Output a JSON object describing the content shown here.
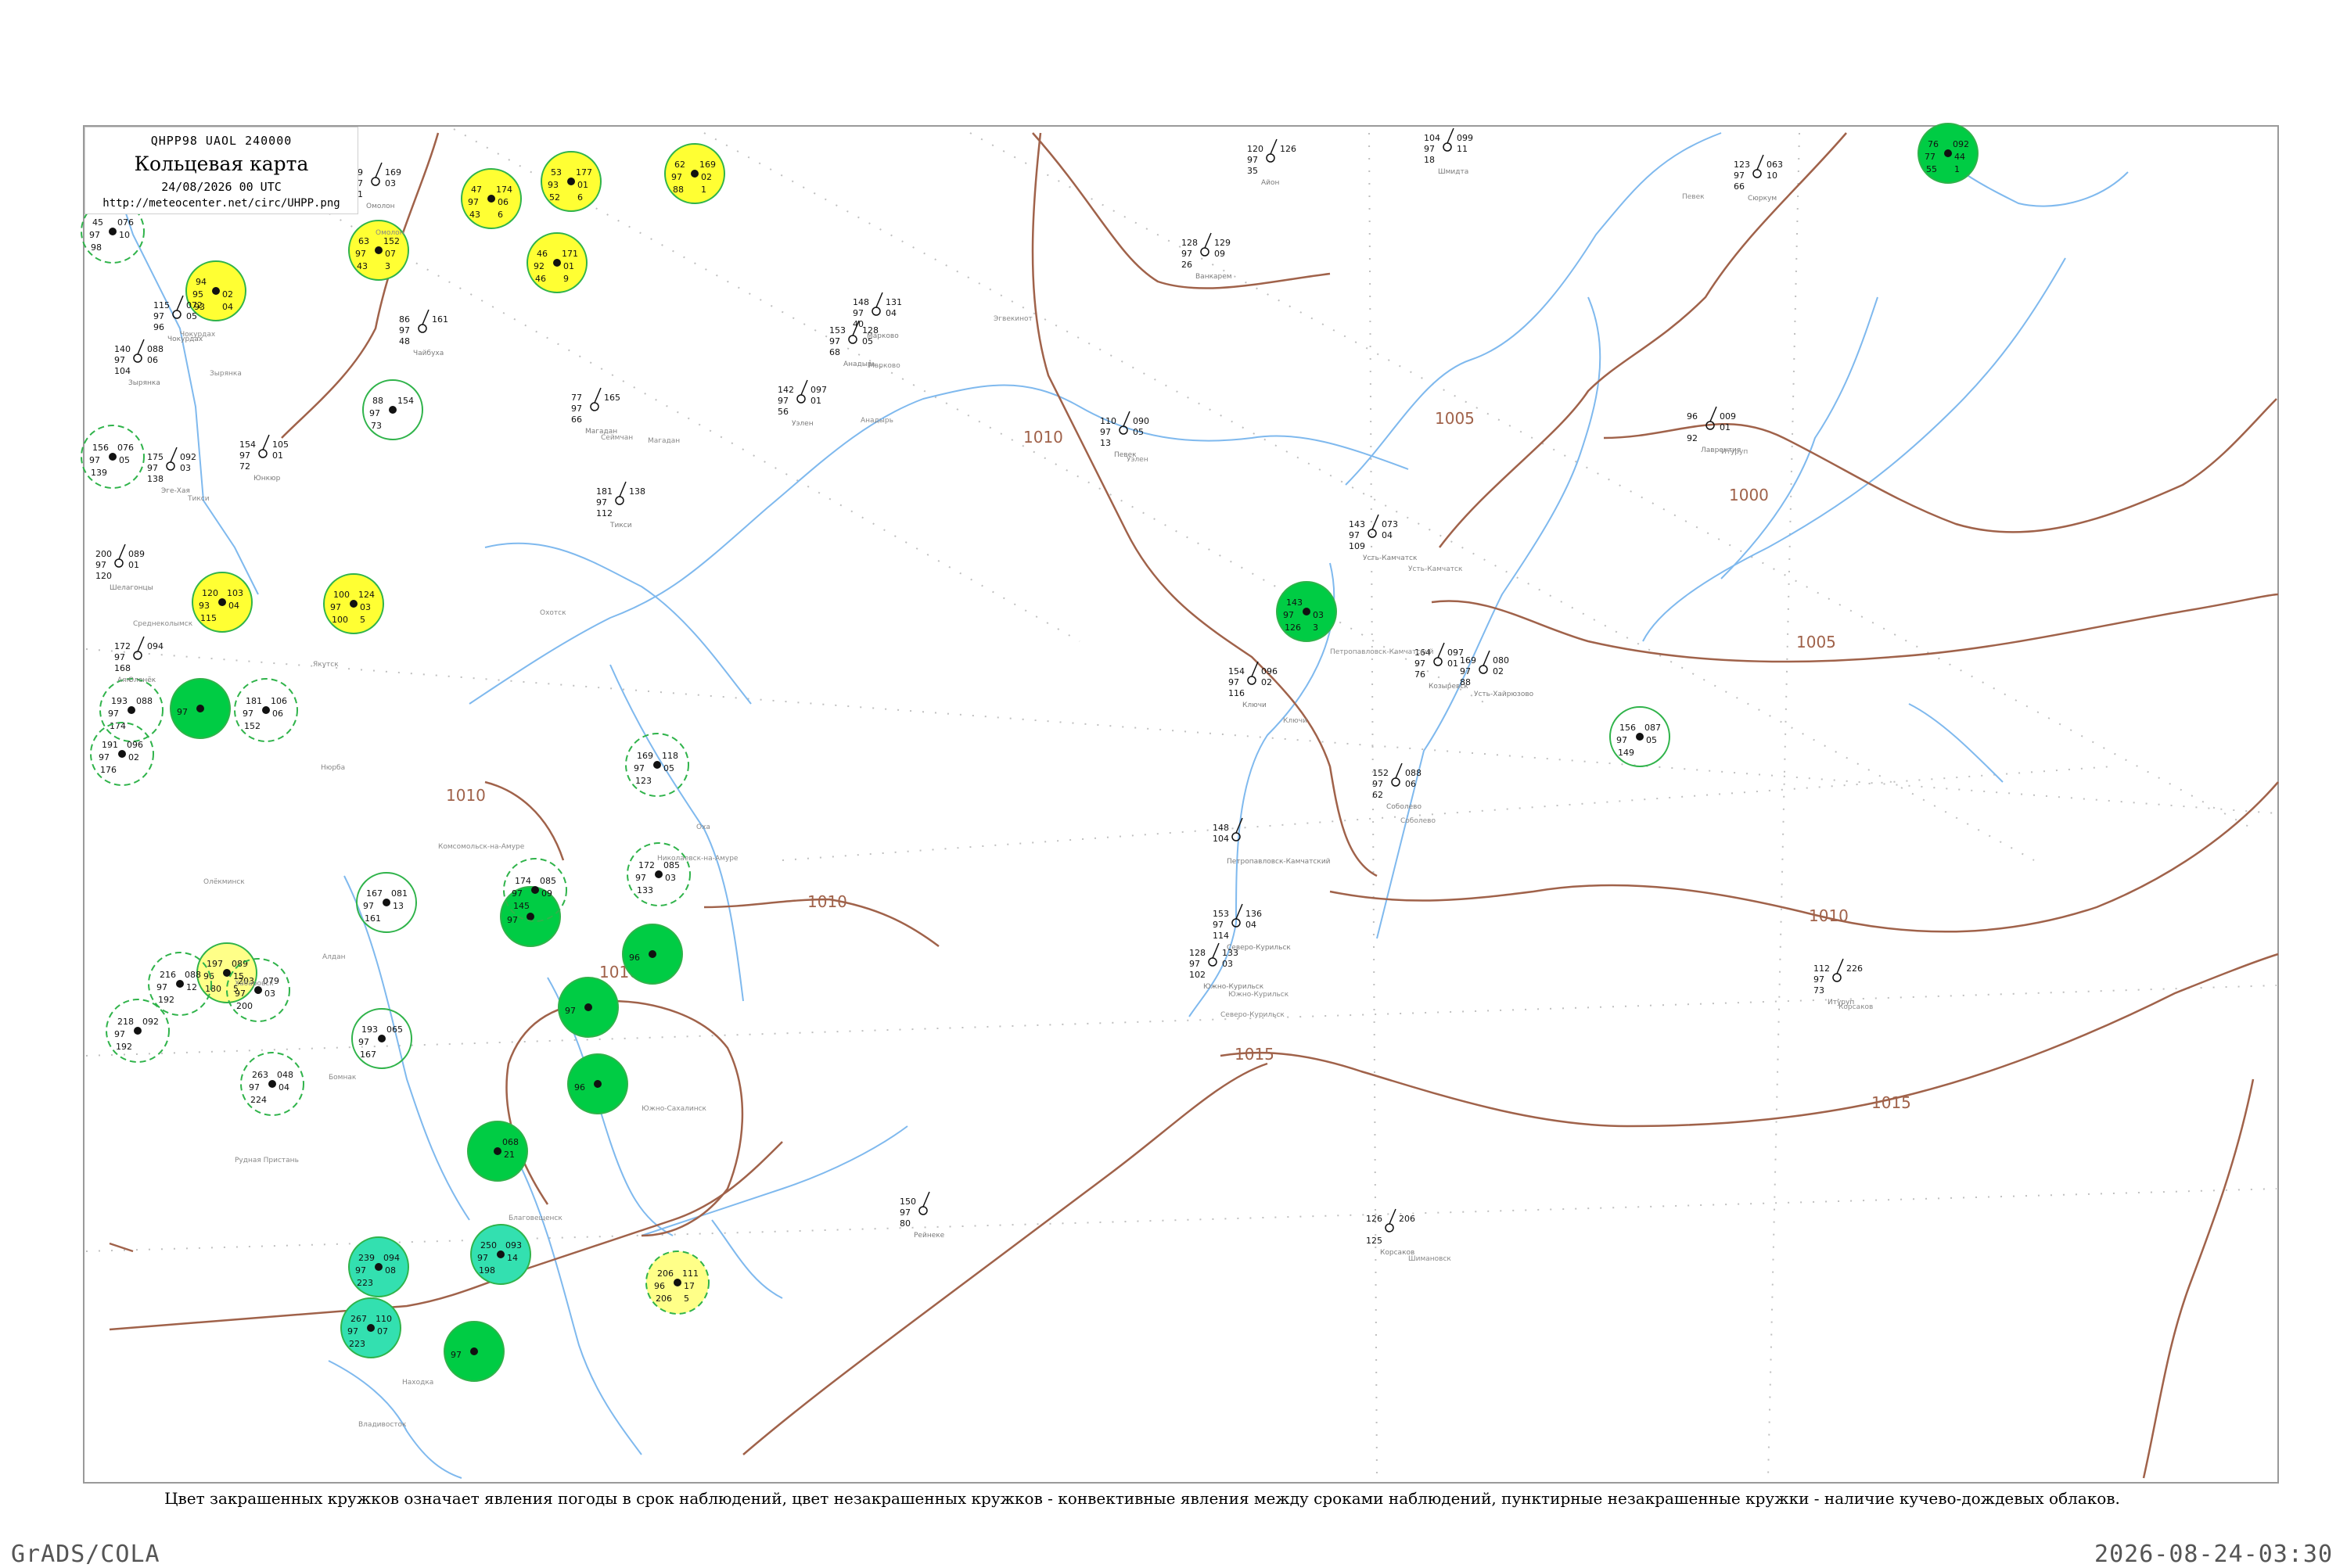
{
  "legend": {
    "code": "QHPP98 UAOL 240000",
    "title": "Кольцевая карта",
    "date": "24/08/2026 00 UTC",
    "url": "http://meteocenter.net/circ/UHPP.png"
  },
  "caption": "Цвет закрашенных кружков означает явления погоды в срок наблюдений, цвет незакрашенных кружков - конвективные явления между сроками наблюдений, пунктирные незакрашенные кружки - наличие кучево-дождевых облаков.",
  "footer": {
    "left": "GrADS/COLA",
    "right": "2026-08-24-03:30"
  },
  "isobars": [
    "1010",
    "1005",
    "1000",
    "1005",
    "1010",
    "1010",
    "1010",
    "1015",
    "1015",
    "1010"
  ],
  "stations": [
    {
      "fill": "#ffff33",
      "ring": "solid",
      "v": [
        "47",
        "174",
        "97",
        "06",
        "43",
        "6"
      ]
    },
    {
      "fill": "#ffff33",
      "ring": "solid",
      "v": [
        "53",
        "177",
        "93",
        "01",
        "52",
        "6"
      ]
    },
    {
      "fill": "#ffff33",
      "ring": "solid",
      "v": [
        "62",
        "169",
        "97",
        "02",
        "88",
        "1"
      ]
    },
    {
      "fill": "#ffff33",
      "ring": "solid",
      "v": [
        "63",
        "152",
        "97",
        "07",
        "43",
        "3"
      ]
    },
    {
      "fill": "#ffff33",
      "ring": "solid",
      "v": [
        "46",
        "171",
        "92",
        "01",
        "46",
        "9"
      ]
    },
    {
      "fill": "#ffff33",
      "ring": "solid",
      "v": [
        "94",
        "",
        "95",
        "02",
        "93",
        "04"
      ]
    },
    {
      "fill": "#ffff33",
      "ring": "solid",
      "v": [
        "120",
        "103",
        "93",
        "04",
        "115",
        ""
      ]
    },
    {
      "fill": "#ffff33",
      "ring": "solid",
      "v": [
        "100",
        "124",
        "97",
        "03",
        "100",
        "5"
      ]
    },
    {
      "fill": "#ffff88",
      "ring": "solid",
      "v": [
        "197",
        "089",
        "96",
        "15",
        "180",
        "5"
      ]
    },
    {
      "fill": "#ffff88",
      "ring": "dash",
      "v": [
        "206",
        "111",
        "96",
        "17",
        "206",
        "5"
      ]
    },
    {
      "fill": "#00cc44",
      "ring": "solid",
      "v": [
        "76",
        "092",
        "77",
        "44",
        "55",
        "1"
      ]
    },
    {
      "fill": "#00cc44",
      "ring": "solid",
      "v": [
        "143",
        "",
        "97",
        "03",
        "126",
        "3"
      ]
    },
    {
      "fill": "#00cc44",
      "ring": "solid",
      "v": [
        "",
        "",
        "97",
        "",
        "",
        ""
      ]
    },
    {
      "fill": "#00cc44",
      "ring": "solid",
      "v": [
        "",
        "",
        "97",
        "",
        "",
        ""
      ]
    },
    {
      "fill": "#00cc44",
      "ring": "solid",
      "v": [
        "",
        "",
        "96",
        "",
        "",
        ""
      ]
    },
    {
      "fill": "#00cc44",
      "ring": "solid",
      "v": [
        "",
        "",
        "97",
        "",
        "",
        ""
      ]
    },
    {
      "fill": "#00cc44",
      "ring": "solid",
      "v": [
        "",
        "",
        "96",
        "",
        "",
        ""
      ]
    },
    {
      "fill": "#00cc44",
      "ring": "solid",
      "v": [
        "",
        "068",
        "",
        "21",
        "",
        ""
      ]
    },
    {
      "fill": "#00cc44",
      "ring": "solid",
      "v": [
        "",
        "",
        "97",
        "",
        "",
        ""
      ]
    },
    {
      "fill": "#33e0b0",
      "ring": "solid",
      "v": [
        "239",
        "094",
        "97",
        "08",
        "223",
        ""
      ]
    },
    {
      "fill": "#33e0b0",
      "ring": "solid",
      "v": [
        "250",
        "093",
        "97",
        "14",
        "198",
        ""
      ]
    },
    {
      "fill": "#33e0b0",
      "ring": "solid",
      "v": [
        "267",
        "110",
        "97",
        "07",
        "223",
        ""
      ]
    },
    {
      "fill": "none",
      "ring": "dash",
      "v": [
        "193",
        "088",
        "97",
        "",
        "174",
        ""
      ]
    },
    {
      "fill": "none",
      "ring": "dash",
      "v": [
        "181",
        "106",
        "97",
        "06",
        "152",
        ""
      ]
    },
    {
      "fill": "none",
      "ring": "dash",
      "v": [
        "191",
        "096",
        "97",
        "02",
        "176",
        ""
      ]
    },
    {
      "fill": "none",
      "ring": "dash",
      "v": [
        "156",
        "076",
        "97",
        "05",
        "139",
        ""
      ]
    },
    {
      "fill": "none",
      "ring": "dash",
      "v": [
        "45",
        "076",
        "97",
        "10",
        "98",
        ""
      ]
    },
    {
      "fill": "none",
      "ring": "dash",
      "v": [
        "172",
        "085",
        "97",
        "03",
        "133",
        ""
      ]
    },
    {
      "fill": "none",
      "ring": "dash",
      "v": [
        "169",
        "118",
        "97",
        "05",
        "123",
        ""
      ]
    },
    {
      "fill": "none",
      "ring": "dash",
      "v": [
        "174",
        "085",
        "97",
        "09",
        "145",
        ""
      ]
    },
    {
      "fill": "none",
      "ring": "dash",
      "v": [
        "216",
        "088",
        "97",
        "12",
        "192",
        ""
      ]
    },
    {
      "fill": "none",
      "ring": "dash",
      "v": [
        "218",
        "092",
        "97",
        "",
        "192",
        ""
      ]
    },
    {
      "fill": "none",
      "ring": "dash",
      "v": [
        "263",
        "048",
        "97",
        "04",
        "224",
        ""
      ]
    },
    {
      "fill": "none",
      "ring": "dash",
      "v": [
        "203",
        "079",
        "97",
        "03",
        "200",
        ""
      ]
    },
    {
      "fill": "none",
      "ring": "solid",
      "v": [
        "88",
        "154",
        "97",
        "",
        "73",
        ""
      ]
    },
    {
      "fill": "none",
      "ring": "solid",
      "v": [
        "167",
        "081",
        "97",
        "13",
        "161",
        ""
      ]
    },
    {
      "fill": "none",
      "ring": "solid",
      "v": [
        "193",
        "065",
        "97",
        "",
        "167",
        ""
      ]
    },
    {
      "fill": "none",
      "ring": "solid",
      "v": [
        "156",
        "087",
        "97",
        "05",
        "149",
        ""
      ]
    }
  ],
  "plain_stations": [
    {
      "v": [
        "49",
        "169",
        "97",
        "03",
        "21"
      ],
      "name": "Омолон"
    },
    {
      "v": [
        "86",
        "161",
        "97",
        "",
        "48"
      ],
      "name": "Чайбуха"
    },
    {
      "v": [
        "77",
        "165",
        "97",
        "",
        "66"
      ],
      "name": "Магадан"
    },
    {
      "v": [
        "115",
        "072",
        "97",
        "05",
        "96"
      ],
      "name": "Чокурдах"
    },
    {
      "v": [
        "140",
        "088",
        "97",
        "06",
        "104"
      ],
      "name": "Зырянка"
    },
    {
      "v": [
        "154",
        "105",
        "97",
        "01",
        "72"
      ],
      "name": "Юнкюр"
    },
    {
      "v": [
        "175",
        "092",
        "97",
        "03",
        "138"
      ],
      "name": "Эге-Хая"
    },
    {
      "v": [
        "200",
        "089",
        "97",
        "01",
        "120"
      ],
      "name": "Шелагонцы"
    },
    {
      "v": [
        "172",
        "094",
        "97",
        "",
        "168"
      ],
      "name": "Оленёк"
    },
    {
      "v": [
        "181",
        "138",
        "97",
        "",
        "112"
      ],
      "name": "Тикси"
    },
    {
      "v": [
        "142",
        "097",
        "97",
        "01",
        "56"
      ],
      "name": "Уэлен"
    },
    {
      "v": [
        "153",
        "128",
        "97",
        "05",
        "68"
      ],
      "name": "Анадырь"
    },
    {
      "v": [
        "148",
        "131",
        "97",
        "04",
        "40"
      ],
      "name": "Марково"
    },
    {
      "v": [
        "110",
        "090",
        "97",
        "05",
        "13"
      ],
      "name": "Певек"
    },
    {
      "v": [
        "120",
        "126",
        "97",
        "",
        "35"
      ],
      "name": "Айон"
    },
    {
      "v": [
        "128",
        "129",
        "97",
        "09",
        "26"
      ],
      "name": "Ванкарем"
    },
    {
      "v": [
        "104",
        "099",
        "97",
        "11",
        "18"
      ],
      "name": "Шмидта"
    },
    {
      "v": [
        "123",
        "063",
        "97",
        "10",
        "66"
      ],
      "name": "Сюркум"
    },
    {
      "v": [
        "143",
        "073",
        "97",
        "04",
        "109"
      ],
      "name": "Усть-Камчатск"
    },
    {
      "v": [
        "154",
        "096",
        "97",
        "02",
        "116"
      ],
      "name": "Ключи"
    },
    {
      "v": [
        "164",
        "097",
        "97",
        "01",
        "76"
      ],
      "name": "Козыревск"
    },
    {
      "v": [
        "169",
        "080",
        "97",
        "02",
        "88"
      ],
      "name": "Усть-Хайрюзово"
    },
    {
      "v": [
        "152",
        "088",
        "97",
        "06",
        "62"
      ],
      "name": "Соболево"
    },
    {
      "v": [
        "148",
        "",
        "104",
        "",
        ""
      ],
      "name": "Петропавловск-Камчатский"
    },
    {
      "v": [
        "153",
        "136",
        "97",
        "04",
        "114"
      ],
      "name": "Северо-Курильск"
    },
    {
      "v": [
        "128",
        "133",
        "97",
        "03",
        "102"
      ],
      "name": "Южно-Курильск"
    },
    {
      "v": [
        "112",
        "226",
        "97",
        "",
        "73"
      ],
      "name": "Итуруп"
    },
    {
      "v": [
        "96",
        "009",
        "",
        "01",
        "92"
      ],
      "name": "Лаврентия"
    },
    {
      "v": [
        "150",
        "",
        "97",
        "",
        "80"
      ],
      "name": "Рейнеке"
    },
    {
      "v": [
        "126",
        "206",
        "",
        "",
        "125"
      ],
      "name": "Корсаков"
    }
  ],
  "place_names": [
    "Певек",
    "Омолон",
    "Чокурдах",
    "Зырянка",
    "Среднеколымск",
    "Анадырь",
    "Марково",
    "Эгвекинот",
    "Уэлен",
    "Сеймчан",
    "Магадан",
    "Охотск",
    "Аян",
    "Николаевск-на-Амуре",
    "Хабаровск",
    "Комсомольск-на-Амуре",
    "Южно-Сахалинск",
    "Оха",
    "Петропавловск-Камчатский",
    "Ключи",
    "Усть-Камчатск",
    "Соболево",
    "Северо-Курильск",
    "Южно-Курильск",
    "Владивосток",
    "Находка",
    "Рудная Пристань",
    "Тикси",
    "Якутск",
    "Алдан",
    "Нюрба",
    "Олёкминск",
    "Бомнак",
    "Благовещенск",
    "Шимановск",
    "Корсаков",
    "Итуруп",
    "Лаврентия"
  ]
}
